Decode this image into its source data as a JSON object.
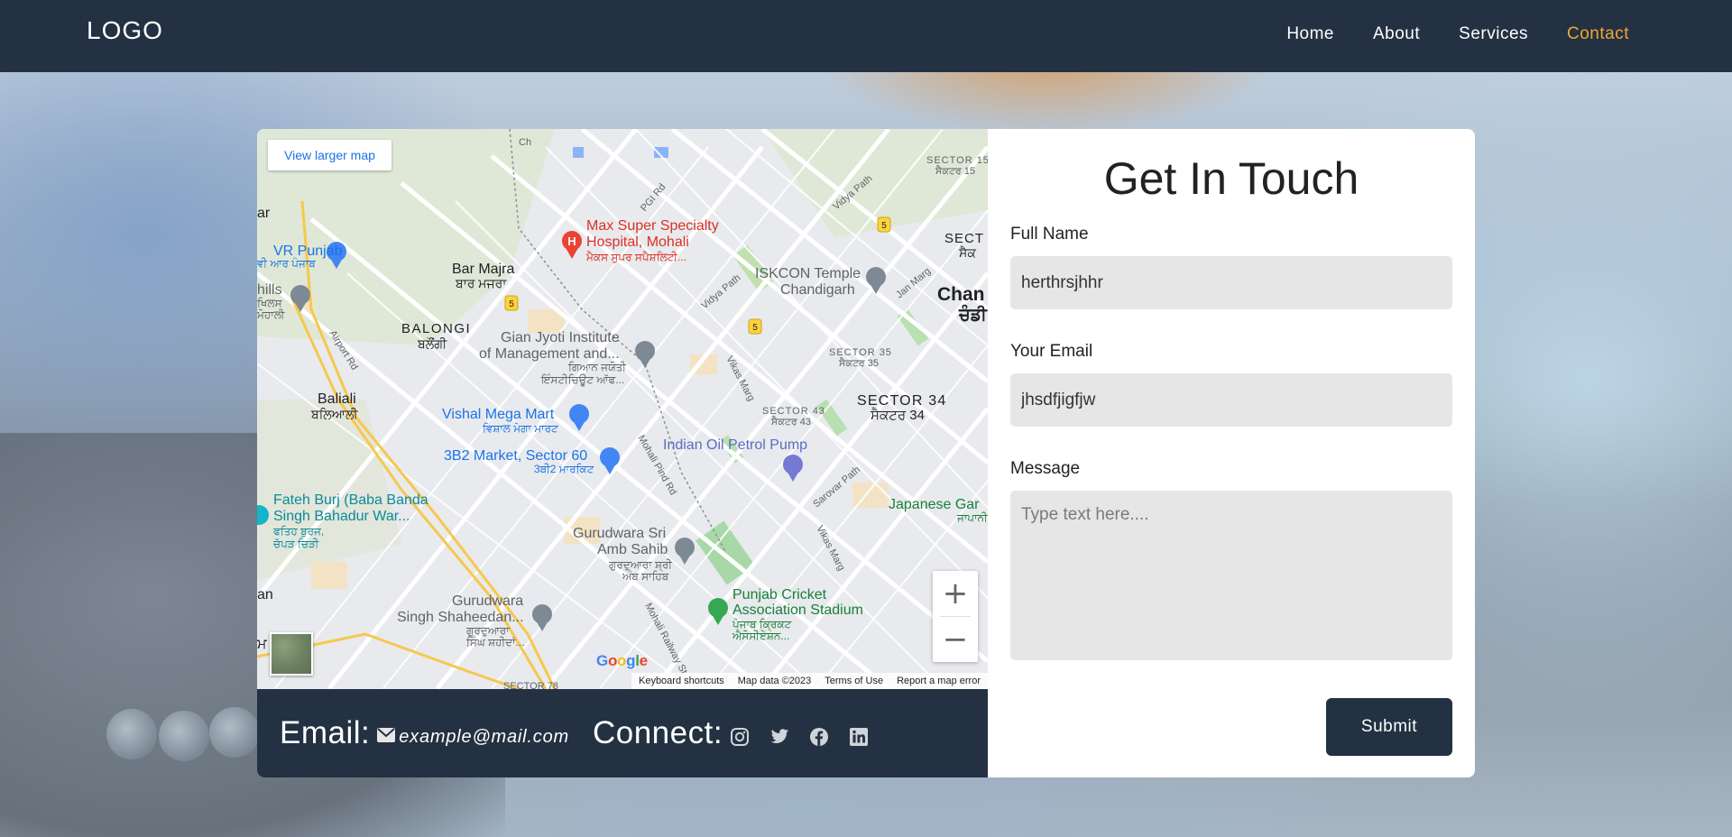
{
  "nav": {
    "logo": "LOGO",
    "links": [
      {
        "label": "Home"
      },
      {
        "label": "About"
      },
      {
        "label": "Services"
      },
      {
        "label": "Contact"
      }
    ],
    "active_color": "#f0a830"
  },
  "map": {
    "larger_map_label": "View larger map",
    "zoom_in": "+",
    "zoom_out": "−",
    "google": [
      "G",
      "o",
      "o",
      "g",
      "l",
      "e"
    ],
    "footer": {
      "shortcuts": "Keyboard shortcuts",
      "data": "Map data ©2023",
      "terms": "Terms of Use",
      "report": "Report a map error"
    },
    "places": [
      {
        "name": "Max Super Specialty",
        "sub": "Hospital, Mohali",
        "local": "ਮੈਕਸ ਸੁਪਰ ਸਪੈਸ਼ਲਿਟੀ..."
      },
      {
        "name": "ISKCON Temple",
        "sub": "Chandigarh"
      },
      {
        "name": "Bar Majra",
        "local": "ਬਾਰ ਮਜਰਾ"
      },
      {
        "name": "BALONGI",
        "local": "ਬਲੌਂਗੀ"
      },
      {
        "name": "Gian Jyoti Institute",
        "sub": "of Management and...",
        "local": "ਗਿਆਨ ਜਯੋਤੀ",
        "local2": "ਇੰਸਟੀਚਿਊਟ ਆੱਫ..."
      },
      {
        "name": "Baliali",
        "local": "ਬਲਿਆਲੀ"
      },
      {
        "name": "Vishal Mega Mart",
        "local": "ਵਿਸ਼ਾਲ ਮੇਗਾ ਮਾਰਟ"
      },
      {
        "name": "3B2 Market, Sector 60",
        "local": "3ਬੀ2 ਮਾਰਕਿਟ"
      },
      {
        "name": "Indian Oil Petrol Pump"
      },
      {
        "name": "SECTOR 34",
        "local": "ਸੈਕਟਰ 34"
      },
      {
        "name": "SECTOR 43",
        "local": "ਸੈਕਟਰ 43"
      },
      {
        "name": "SECTOR 35",
        "local": "ਸੈਕਟਰ 35"
      },
      {
        "name": "SECTOR 15",
        "local": "ਸੈਕਟਰ 15"
      },
      {
        "name": "Fateh Burj (Baba Banda",
        "sub": "Singh Bahadur War...",
        "local": "ਫਤਿਹ ਬੁਰਜ,",
        "local2": "ਚੱਪੜ ਚਿੜੀ"
      },
      {
        "name": "Gurudwara Sri",
        "sub": "Amb Sahib",
        "local": "ਗੁਰਦੁਆਰਾ ਸ਼੍ਰੀ",
        "local2": "ਅੰਬ ਸਾਹਿਬ"
      },
      {
        "name": "Gurudwara",
        "sub": "Singh Shaheedan...",
        "local": "ਗੁਰਦੁਆਰਾ",
        "local2": "ਸਿੰਘ ਸ਼ਹੀਦਾਂ..."
      },
      {
        "name": "Punjab Cricket",
        "sub": "Association Stadium",
        "local": "ਪੰਜਾਬ ਕ੍ਰਿਕਟ",
        "local2": "ਐਸੋਸੀਏਸ਼ਨ..."
      },
      {
        "name": "Japanese Gar",
        "local": "ਜਾਪਾਨੀ"
      },
      {
        "name": "Chan",
        "local": "ਚੰਡੀ"
      },
      {
        "name": "VR Punjab",
        "local": "ਵੀ ਆਰ ਪੰਜਾਬ"
      },
      {
        "name": "hills",
        "local": "ਖਿਲਸ",
        "local2": "ਮੋਹਾਲੀ"
      },
      {
        "name": "SECT",
        "local": "ਸੈਕ"
      },
      {
        "name": "an",
        "local": "ਮ"
      },
      {
        "name": "ar"
      }
    ],
    "roads": [
      "Airport Rd",
      "PGI Rd",
      "Vidya Path",
      "Vidya Path",
      "Jan Marg",
      "Vikas Marg",
      "Mohali Pind Rd",
      "Sarovar Path",
      "Vikas Marg",
      "Mohali Railway St",
      "SECTOR 78",
      "Ch"
    ],
    "route_badges": [
      "5",
      "5",
      "5"
    ]
  },
  "contact_bar": {
    "email_label": "Email:",
    "email_value": "example@mail.com",
    "connect_label": "Connect:",
    "social_icons": [
      "instagram-icon",
      "twitter-icon",
      "facebook-icon",
      "linkedin-icon"
    ]
  },
  "form": {
    "title": "Get In Touch",
    "name_label": "Full Name",
    "name_value": "herthrsjhhr",
    "email_label": "Your Email",
    "email_value": "jhsdfjigfjw",
    "message_label": "Message",
    "message_placeholder": "Type text here....",
    "submit_label": "Submit"
  }
}
